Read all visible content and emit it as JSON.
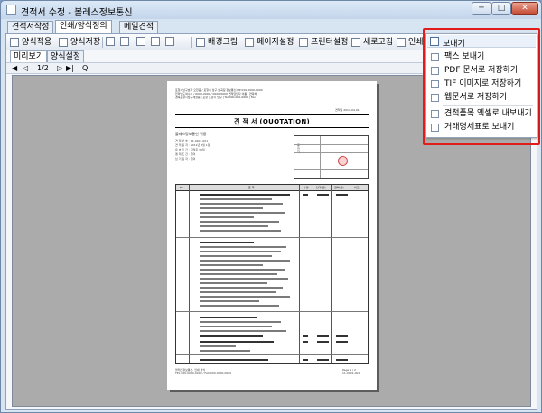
{
  "window": {
    "title": "견적서 수정 - 볼레스정보통신",
    "controls": {
      "minimize": "─",
      "maximize": "□",
      "close": "✕"
    }
  },
  "tabs": [
    {
      "label": "견적서작성",
      "active": false
    },
    {
      "label": "인쇄/양식정의",
      "active": true
    },
    {
      "label": "메일견적",
      "active": false
    }
  ],
  "toolbar": {
    "form_select": "양식적용",
    "form_save": "양식저장",
    "background": "배경그림",
    "page_setup": "페이지설정",
    "printer_setup": "프린터설정",
    "refresh": "새로고침",
    "print": "인쇄",
    "send": "보내기"
  },
  "subtabs": [
    {
      "label": "미리보기",
      "active": true
    },
    {
      "label": "양식설정",
      "active": false
    }
  ],
  "navbar": {
    "first": "◀",
    "prev": "◁",
    "page": "1/2",
    "next": "▷",
    "last": "▶|",
    "zoom": "Q"
  },
  "document": {
    "header_lines": [
      "포항시남구효자 오천읍 / 포항시 남구 성곡길 정보통신 HP:010-0000-0000",
      "전라남도여수시 / 0000-0000 / 0000-0000 견적담당자 이름 / 연락처",
      "경북포항시남구제철동 | 포항 포항시 남구 | Tel:000-000-0000 | Fax"
    ],
    "date": "견적일 2011-04-01",
    "title": "견 적 서 (QUOTATION)",
    "customer": "볼레스정보통신 귀중",
    "customer_lines": [
      "견 적 번 호 : 11-0401-001",
      "견 적 일 자 : 2011년 4월 1일",
      "유 효 기 간 : 견적후 30일",
      "결 제 조 건 : 협의",
      "납 기 일 자 : 협의"
    ],
    "supplier_label": "공급자",
    "table_headers": [
      "No",
      "품 목",
      "수량",
      "단가(원)",
      "금액(원)",
      "비고"
    ],
    "footer_left": [
      "볼레스정보통신, 인쇄 양식",
      "TEL 000-0000-0000 / FAX 000-0000-0000"
    ],
    "footer_right": [
      "Page 1 / 2",
      "11-0401-001"
    ]
  },
  "send_menu": {
    "header": "보내기",
    "items": [
      {
        "label": "팩스 보내기",
        "icon": "fax-icon"
      },
      {
        "label": "PDF 문서로 저장하기",
        "icon": "pdf-icon"
      },
      {
        "label": "TIF 이미지로 저장하기",
        "icon": "tif-icon"
      },
      {
        "label": "웹문서로 저장하기",
        "icon": "web-icon"
      },
      {
        "label": "견적품목 엑셀로 내보내기",
        "icon": "excel-icon"
      },
      {
        "label": "거래명세표로 보내기",
        "icon": "invoice-icon"
      }
    ]
  },
  "colors": {
    "highlight": "#e21b1b",
    "accent": "#4f6f95"
  }
}
